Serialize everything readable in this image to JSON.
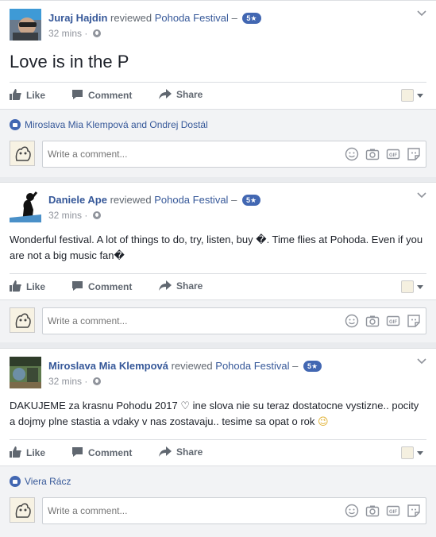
{
  "posts": [
    {
      "author": "Juraj Hajdin",
      "verb": "reviewed",
      "page": "Pohoda Festival",
      "dash": "–",
      "rating": "5★",
      "time": "32 mins",
      "sep": "·",
      "body": "Love is in the P",
      "likes_names": "Miroslava Mia Klempová and Ondrej Dostál",
      "comment_placeholder": "Write a comment..."
    },
    {
      "author": "Daniele Ape",
      "verb": "reviewed",
      "page": "Pohoda Festival",
      "dash": "–",
      "rating": "5★",
      "time": "32 mins",
      "sep": "·",
      "body": "Wonderful festival. A lot of things to do, try, listen, buy �. Time flies at Pohoda. Even if you are not a big music fan�",
      "comment_placeholder": "Write a comment..."
    },
    {
      "author": "Miroslava Mia Klempová",
      "verb": "reviewed",
      "page": "Pohoda Festival",
      "dash": "–",
      "rating": "5★",
      "time": "32 mins",
      "sep": "·",
      "body": "DAKUJEME za krasnu Pohodu 2017 ♡ ine slova nie su teraz dostatocne vystizne.. pocity a dojmy plne stastia a vdaky v nas zostavaju.. tesime sa opat o rok",
      "body_emoji": "😉",
      "likes_names": "Viera Rácz",
      "comment_placeholder": "Write a comment..."
    }
  ],
  "actions": {
    "like": "Like",
    "comment": "Comment",
    "share": "Share"
  },
  "icons": {
    "globe": "globe-icon",
    "chevron": "chevron-down-icon",
    "like": "thumbs-up-icon",
    "comment": "speech-bubble-icon",
    "share": "share-arrow-icon",
    "emoji": "smiley-icon",
    "camera": "camera-icon",
    "gif": "gif-icon",
    "sticker": "sticker-icon"
  },
  "colors": {
    "link": "#365899",
    "brand": "#4267b2",
    "muted": "#90949c",
    "background": "#e9ebee"
  }
}
